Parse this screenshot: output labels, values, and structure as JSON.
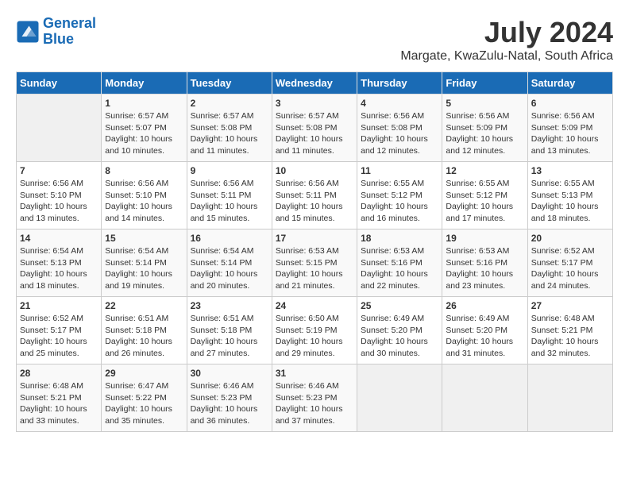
{
  "header": {
    "logo_line1": "General",
    "logo_line2": "Blue",
    "month": "July 2024",
    "location": "Margate, KwaZulu-Natal, South Africa"
  },
  "weekdays": [
    "Sunday",
    "Monday",
    "Tuesday",
    "Wednesday",
    "Thursday",
    "Friday",
    "Saturday"
  ],
  "weeks": [
    [
      {
        "day": "",
        "sunrise": "",
        "sunset": "",
        "daylight": ""
      },
      {
        "day": "1",
        "sunrise": "Sunrise: 6:57 AM",
        "sunset": "Sunset: 5:07 PM",
        "daylight": "Daylight: 10 hours and 10 minutes."
      },
      {
        "day": "2",
        "sunrise": "Sunrise: 6:57 AM",
        "sunset": "Sunset: 5:08 PM",
        "daylight": "Daylight: 10 hours and 11 minutes."
      },
      {
        "day": "3",
        "sunrise": "Sunrise: 6:57 AM",
        "sunset": "Sunset: 5:08 PM",
        "daylight": "Daylight: 10 hours and 11 minutes."
      },
      {
        "day": "4",
        "sunrise": "Sunrise: 6:56 AM",
        "sunset": "Sunset: 5:08 PM",
        "daylight": "Daylight: 10 hours and 12 minutes."
      },
      {
        "day": "5",
        "sunrise": "Sunrise: 6:56 AM",
        "sunset": "Sunset: 5:09 PM",
        "daylight": "Daylight: 10 hours and 12 minutes."
      },
      {
        "day": "6",
        "sunrise": "Sunrise: 6:56 AM",
        "sunset": "Sunset: 5:09 PM",
        "daylight": "Daylight: 10 hours and 13 minutes."
      }
    ],
    [
      {
        "day": "7",
        "sunrise": "Sunrise: 6:56 AM",
        "sunset": "Sunset: 5:10 PM",
        "daylight": "Daylight: 10 hours and 13 minutes."
      },
      {
        "day": "8",
        "sunrise": "Sunrise: 6:56 AM",
        "sunset": "Sunset: 5:10 PM",
        "daylight": "Daylight: 10 hours and 14 minutes."
      },
      {
        "day": "9",
        "sunrise": "Sunrise: 6:56 AM",
        "sunset": "Sunset: 5:11 PM",
        "daylight": "Daylight: 10 hours and 15 minutes."
      },
      {
        "day": "10",
        "sunrise": "Sunrise: 6:56 AM",
        "sunset": "Sunset: 5:11 PM",
        "daylight": "Daylight: 10 hours and 15 minutes."
      },
      {
        "day": "11",
        "sunrise": "Sunrise: 6:55 AM",
        "sunset": "Sunset: 5:12 PM",
        "daylight": "Daylight: 10 hours and 16 minutes."
      },
      {
        "day": "12",
        "sunrise": "Sunrise: 6:55 AM",
        "sunset": "Sunset: 5:12 PM",
        "daylight": "Daylight: 10 hours and 17 minutes."
      },
      {
        "day": "13",
        "sunrise": "Sunrise: 6:55 AM",
        "sunset": "Sunset: 5:13 PM",
        "daylight": "Daylight: 10 hours and 18 minutes."
      }
    ],
    [
      {
        "day": "14",
        "sunrise": "Sunrise: 6:54 AM",
        "sunset": "Sunset: 5:13 PM",
        "daylight": "Daylight: 10 hours and 18 minutes."
      },
      {
        "day": "15",
        "sunrise": "Sunrise: 6:54 AM",
        "sunset": "Sunset: 5:14 PM",
        "daylight": "Daylight: 10 hours and 19 minutes."
      },
      {
        "day": "16",
        "sunrise": "Sunrise: 6:54 AM",
        "sunset": "Sunset: 5:14 PM",
        "daylight": "Daylight: 10 hours and 20 minutes."
      },
      {
        "day": "17",
        "sunrise": "Sunrise: 6:53 AM",
        "sunset": "Sunset: 5:15 PM",
        "daylight": "Daylight: 10 hours and 21 minutes."
      },
      {
        "day": "18",
        "sunrise": "Sunrise: 6:53 AM",
        "sunset": "Sunset: 5:16 PM",
        "daylight": "Daylight: 10 hours and 22 minutes."
      },
      {
        "day": "19",
        "sunrise": "Sunrise: 6:53 AM",
        "sunset": "Sunset: 5:16 PM",
        "daylight": "Daylight: 10 hours and 23 minutes."
      },
      {
        "day": "20",
        "sunrise": "Sunrise: 6:52 AM",
        "sunset": "Sunset: 5:17 PM",
        "daylight": "Daylight: 10 hours and 24 minutes."
      }
    ],
    [
      {
        "day": "21",
        "sunrise": "Sunrise: 6:52 AM",
        "sunset": "Sunset: 5:17 PM",
        "daylight": "Daylight: 10 hours and 25 minutes."
      },
      {
        "day": "22",
        "sunrise": "Sunrise: 6:51 AM",
        "sunset": "Sunset: 5:18 PM",
        "daylight": "Daylight: 10 hours and 26 minutes."
      },
      {
        "day": "23",
        "sunrise": "Sunrise: 6:51 AM",
        "sunset": "Sunset: 5:18 PM",
        "daylight": "Daylight: 10 hours and 27 minutes."
      },
      {
        "day": "24",
        "sunrise": "Sunrise: 6:50 AM",
        "sunset": "Sunset: 5:19 PM",
        "daylight": "Daylight: 10 hours and 29 minutes."
      },
      {
        "day": "25",
        "sunrise": "Sunrise: 6:49 AM",
        "sunset": "Sunset: 5:20 PM",
        "daylight": "Daylight: 10 hours and 30 minutes."
      },
      {
        "day": "26",
        "sunrise": "Sunrise: 6:49 AM",
        "sunset": "Sunset: 5:20 PM",
        "daylight": "Daylight: 10 hours and 31 minutes."
      },
      {
        "day": "27",
        "sunrise": "Sunrise: 6:48 AM",
        "sunset": "Sunset: 5:21 PM",
        "daylight": "Daylight: 10 hours and 32 minutes."
      }
    ],
    [
      {
        "day": "28",
        "sunrise": "Sunrise: 6:48 AM",
        "sunset": "Sunset: 5:21 PM",
        "daylight": "Daylight: 10 hours and 33 minutes."
      },
      {
        "day": "29",
        "sunrise": "Sunrise: 6:47 AM",
        "sunset": "Sunset: 5:22 PM",
        "daylight": "Daylight: 10 hours and 35 minutes."
      },
      {
        "day": "30",
        "sunrise": "Sunrise: 6:46 AM",
        "sunset": "Sunset: 5:23 PM",
        "daylight": "Daylight: 10 hours and 36 minutes."
      },
      {
        "day": "31",
        "sunrise": "Sunrise: 6:46 AM",
        "sunset": "Sunset: 5:23 PM",
        "daylight": "Daylight: 10 hours and 37 minutes."
      },
      {
        "day": "",
        "sunrise": "",
        "sunset": "",
        "daylight": ""
      },
      {
        "day": "",
        "sunrise": "",
        "sunset": "",
        "daylight": ""
      },
      {
        "day": "",
        "sunrise": "",
        "sunset": "",
        "daylight": ""
      }
    ]
  ]
}
